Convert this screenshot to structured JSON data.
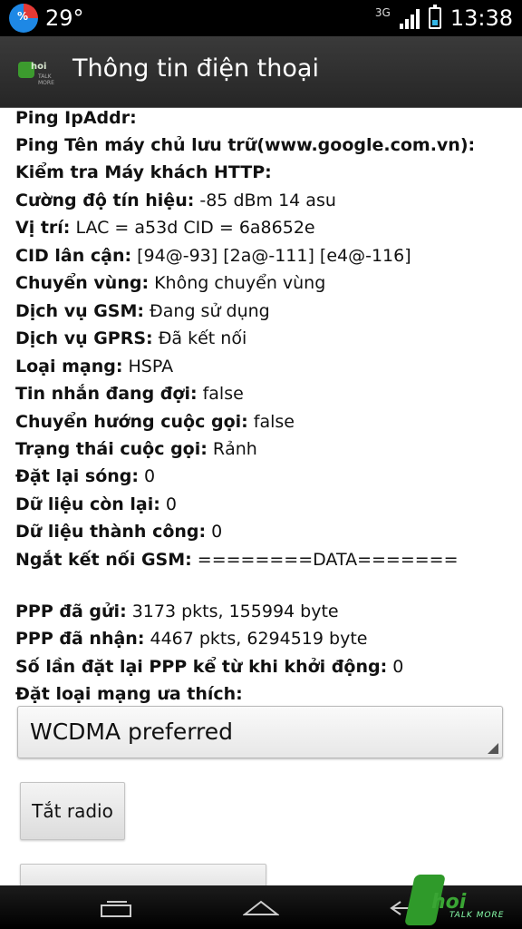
{
  "status_bar": {
    "percent_icon_text": "%",
    "temperature": "29°",
    "network_type": "3G",
    "clock": "13:38",
    "battery_level": 0.4
  },
  "action_bar": {
    "logo_word": "hoi",
    "logo_sub": "TALK MORE",
    "title": "Thông tin điện thoại"
  },
  "info": [
    {
      "k": "Ping IpAddr:",
      "v": ""
    },
    {
      "k": "Ping Tên máy chủ lưu trữ(www.google.com.vn):",
      "v": ""
    },
    {
      "k": "Kiểm tra Máy khách HTTP:",
      "v": ""
    },
    {
      "k": "Cường độ tín hiệu:",
      "v": " -85 dBm   14 asu"
    },
    {
      "k": "Vị trí:",
      "v": " LAC = a53d   CID = 6a8652e"
    },
    {
      "k": "CID lân cận:",
      "v": " [94@-93] [2a@-111] [e4@-116]"
    },
    {
      "k": "Chuyển vùng:",
      "v": " Không chuyển vùng"
    },
    {
      "k": "Dịch vụ GSM:",
      "v": " Đang sử dụng"
    },
    {
      "k": "Dịch vụ GPRS:",
      "v": " Đã kết nối"
    },
    {
      "k": "Loại mạng:",
      "v": " HSPA"
    },
    {
      "k": "Tin nhắn đang đợi:",
      "v": " false"
    },
    {
      "k": "Chuyển hướng cuộc gọi:",
      "v": " false"
    },
    {
      "k": "Trạng thái cuộc gọi:",
      "v": " Rảnh"
    },
    {
      "k": "Đặt lại sóng:",
      "v": " 0"
    },
    {
      "k": "Dữ liệu còn lại:",
      "v": " 0"
    },
    {
      "k": "Dữ liệu thành công:",
      "v": " 0"
    },
    {
      "k": "Ngắt kết nối GSM:",
      "v": " ========DATA======="
    },
    {
      "k": "PPP đã gửi:",
      "v": " 3173 pkts, 155994 byte"
    },
    {
      "k": "PPP đã nhận:",
      "v": " 4467 pkts, 6294519 byte"
    },
    {
      "k": "Số lần đặt lại PPP kể từ khi khởi động:",
      "v": " 0"
    },
    {
      "k": "Đặt loại mạng ưa thích:",
      "v": ""
    }
  ],
  "network_select": {
    "value": "WCDMA preferred"
  },
  "buttons": {
    "radio_off": "Tắt radio"
  },
  "watermark": {
    "word": "hoi",
    "sub": "TALK MORE"
  }
}
